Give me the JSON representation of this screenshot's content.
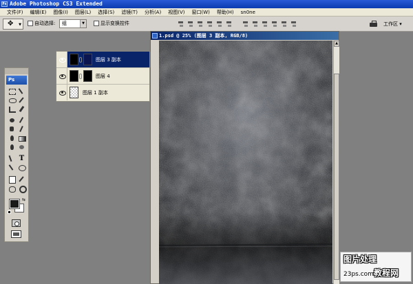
{
  "app": {
    "title": "Adobe Photoshop CS3 Extended"
  },
  "menubar": {
    "items": [
      "文件(F)",
      "编辑(E)",
      "图像(I)",
      "图层(L)",
      "选择(S)",
      "滤镜(T)",
      "分析(A)",
      "视图(V)",
      "窗口(W)",
      "帮助(H)",
      "sn0ne"
    ]
  },
  "options_bar": {
    "auto_select_label": "自动选择:",
    "auto_select_value": "组",
    "show_transform_label": "显示变换控件",
    "workspace_label": "工作区 ▾"
  },
  "layers": [
    {
      "name": "图层 3 副本",
      "selected": true,
      "thumb": "black",
      "mask": true
    },
    {
      "name": "图层 4",
      "selected": false,
      "thumb": "black",
      "mask": true
    },
    {
      "name": "图层 1 副本",
      "selected": false,
      "thumb": "checker",
      "mask": false
    }
  ],
  "document": {
    "title": "1.psd @ 25% (图层 3 副本, RGB/8)"
  },
  "tools": {
    "logo": "Ps",
    "type_glyph": "T"
  },
  "watermark": {
    "line1": "图片处理",
    "line2_prefix": "23ps.com",
    "line2_suffix": "教程网"
  },
  "colors": {
    "selection": "#0a246a",
    "foreground_color": "#1a1a1a",
    "background_color": "#ffffff"
  }
}
